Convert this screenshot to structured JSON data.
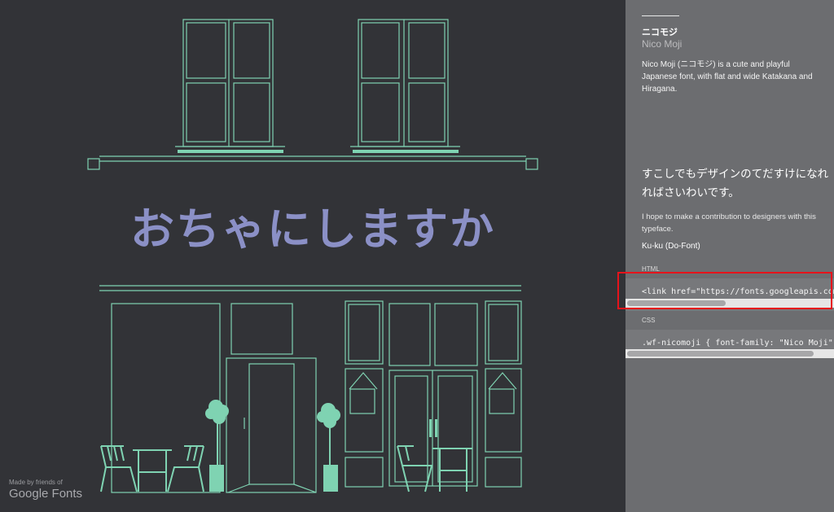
{
  "hero": {
    "title": "おちゃにしますか"
  },
  "credit": {
    "made_by": "Made by friends of",
    "brand": "Google Fonts"
  },
  "font_panel": {
    "name_jp": "ニコモジ",
    "name_en": "Nico Moji",
    "description": "Nico Moji (ニコモジ) is a cute and playful Japanese font, with flat and wide Katakana and Hiragana.",
    "sample_text": "すこしでもデザインのてだすけになれればさいわいです。",
    "quote": "I hope to make a contribution to designers with this typeface.",
    "author": "Ku-ku (Do-Font)",
    "html_label": "HTML",
    "html_code": "<link href=\"https://fonts.googleapis.com/earlyaccess/nicomoji.css\" rel=\"stylesheet\">",
    "html_scroll_fraction": 0.48,
    "css_label": "CSS",
    "css_code": ".wf-nicomoji { font-family: \"Nico Moji\"; }",
    "css_scroll_fraction": 0.91
  },
  "colors": {
    "background": "#323337",
    "line_art": "#7fd3b2",
    "title": "#8b90c6",
    "panel": "#6c6d70",
    "highlight": "#e6131b"
  }
}
